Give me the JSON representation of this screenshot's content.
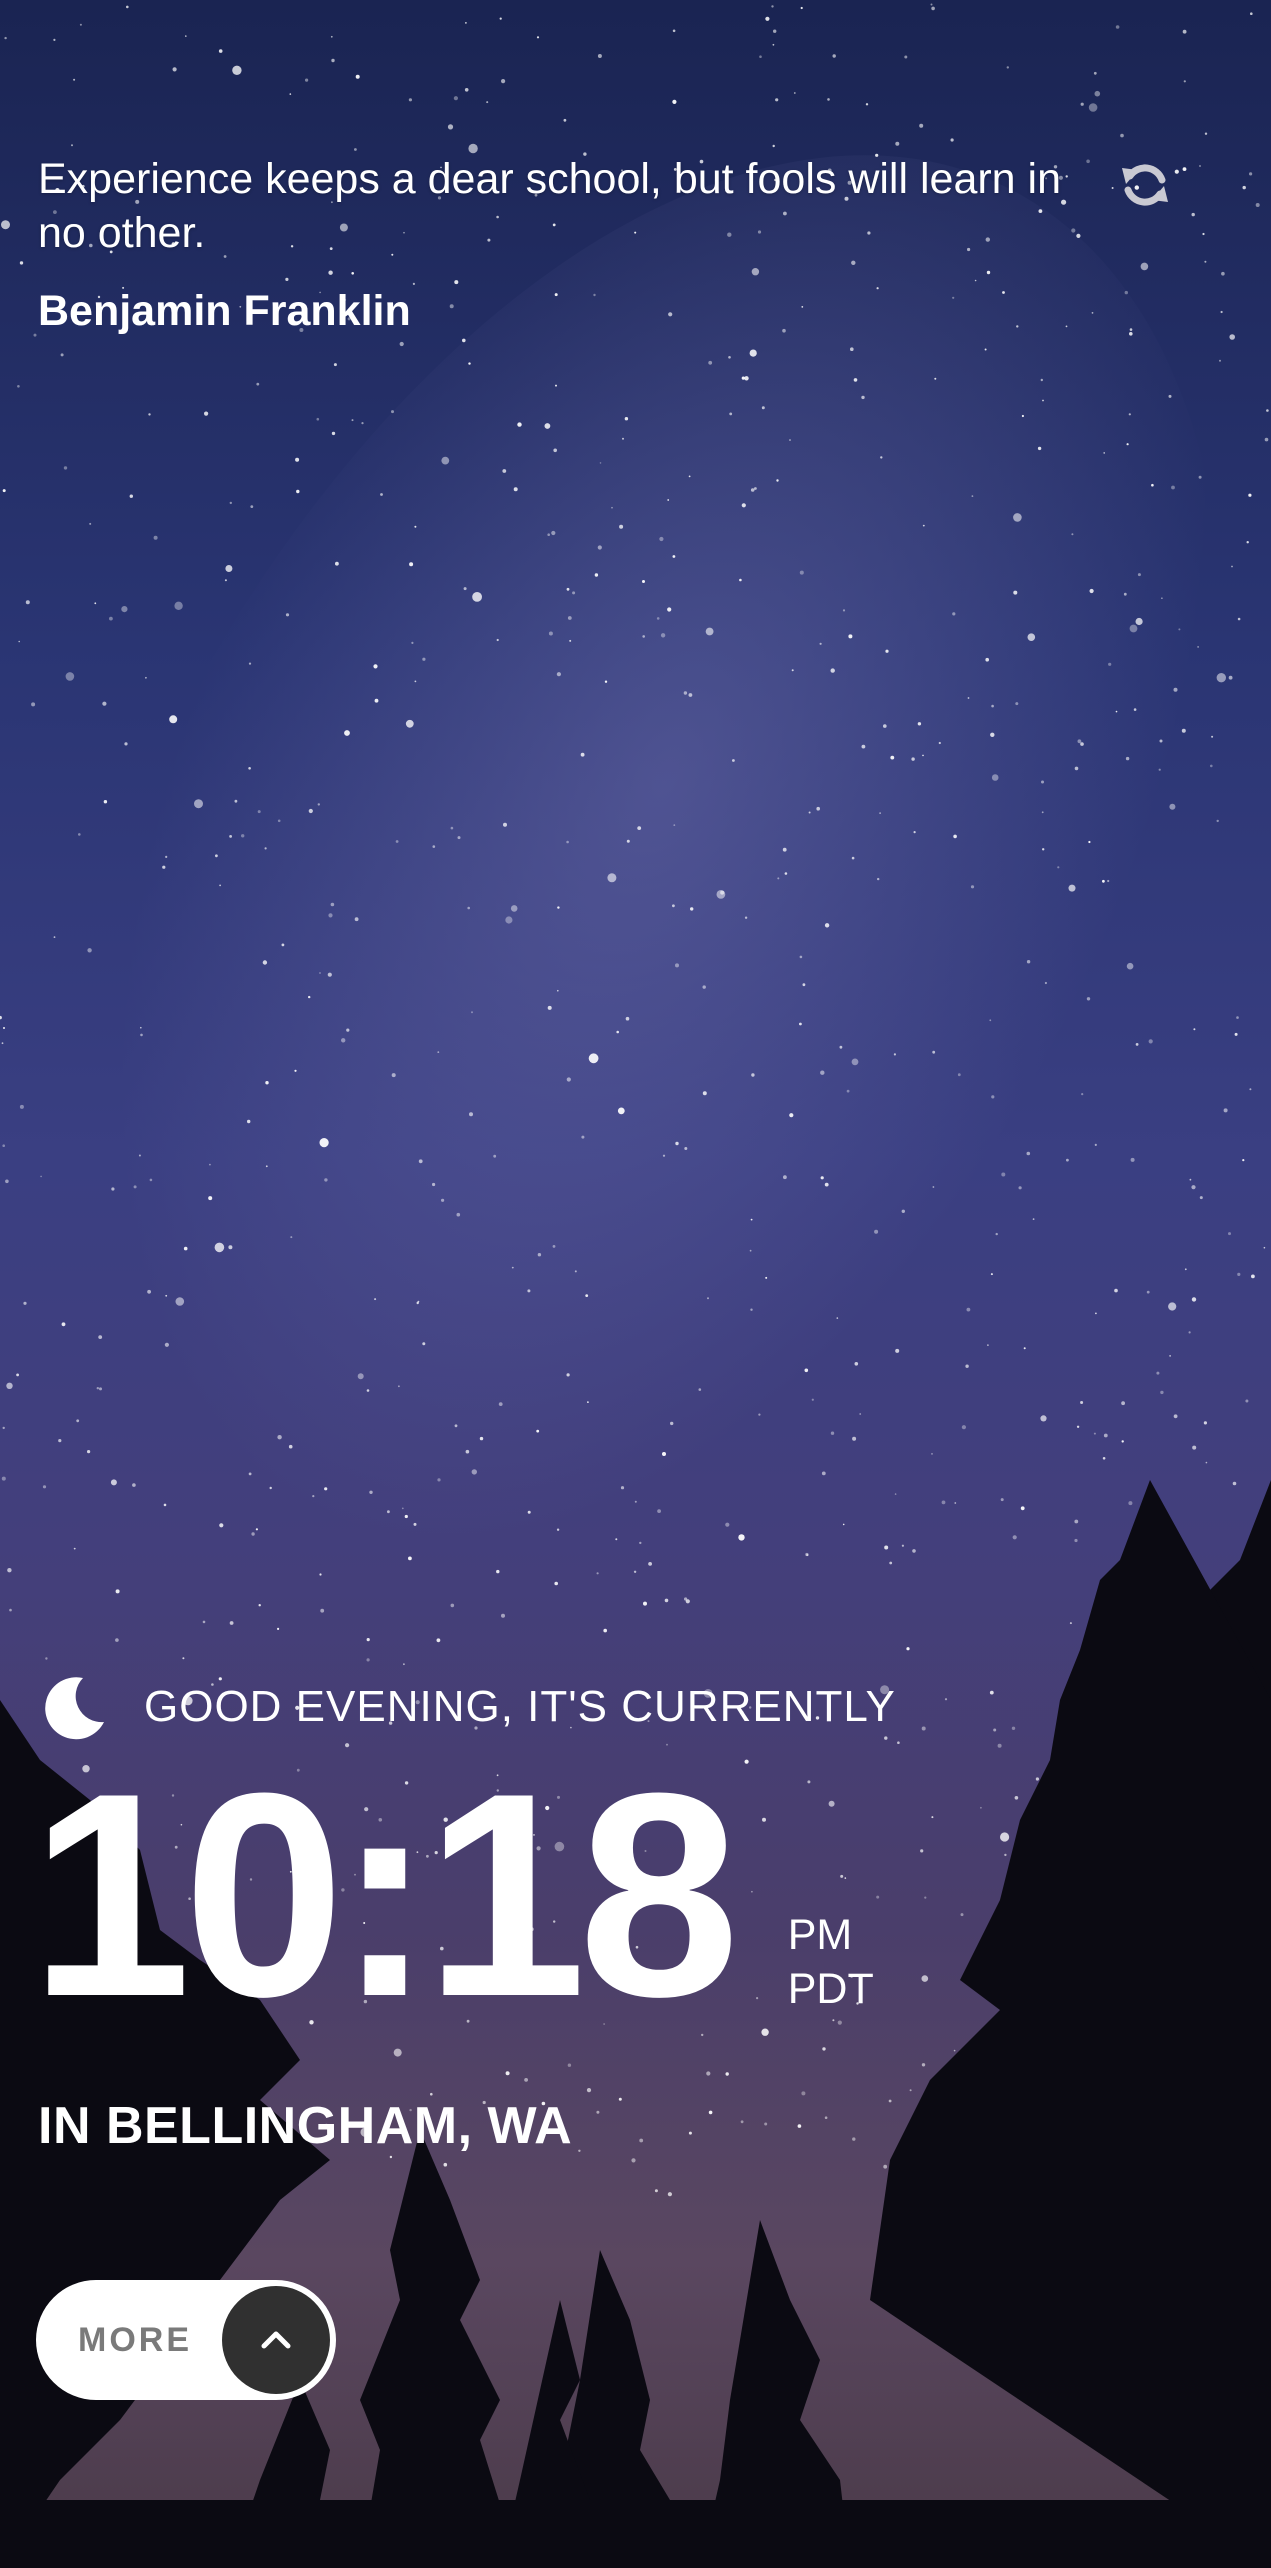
{
  "quote": {
    "text": "Experience keeps a dear school, but fools will learn in no other.",
    "author": "Benjamin Franklin",
    "refresh_icon": "refresh-icon"
  },
  "greeting": {
    "icon": "moon-icon",
    "text": "GOOD EVENING, IT'S CURRENTLY"
  },
  "clock": {
    "time": "10:18",
    "period": "PM",
    "timezone": "PDT"
  },
  "location": {
    "text": "IN BELLINGHAM, WA"
  },
  "more_button": {
    "label": "MORE",
    "icon": "chevron-up-icon"
  },
  "colors": {
    "text": "#ffffff",
    "button_bg": "#ffffff",
    "button_label": "#7a7a7a",
    "arrow_circle": "#303030"
  }
}
